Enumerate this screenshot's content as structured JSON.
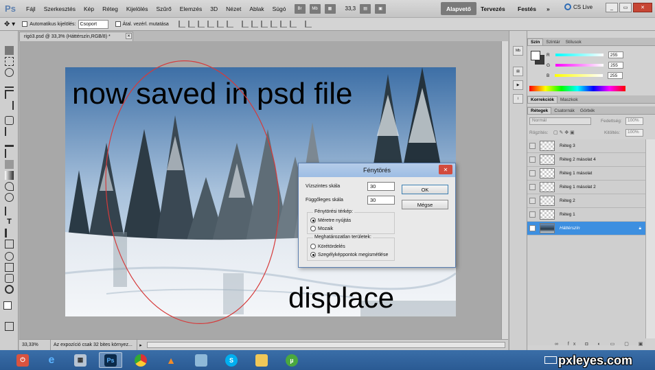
{
  "app": {
    "logo": "Ps",
    "menu": [
      "Fájl",
      "Szerkesztés",
      "Kép",
      "Réteg",
      "Kijelölés",
      "Szűrő",
      "Elemzés",
      "3D",
      "Nézet",
      "Ablak",
      "Súgó"
    ],
    "zoom": "33,3",
    "workspaces": [
      "Alapvető",
      "Tervezés",
      "Festés"
    ],
    "more": "»",
    "cs_live": "CS Live"
  },
  "options": {
    "auto_select_label": "Automatikus kijelölés:",
    "auto_select_value": "Csoport",
    "transform_label": "Átal. vezérl. mutatása"
  },
  "document": {
    "tab_title": "rigó3.psd @ 33,3% (Háttérszín,RGB/8) *",
    "overlay_text_1": "now saved in psd file",
    "overlay_text_2": "displace",
    "status_zoom": "33,33%",
    "status_info": "Az expozíció csak 32 bites környez..."
  },
  "dialog": {
    "title": "Fénytörés",
    "horizontal_label": "Vízszintes skála",
    "horizontal_value": "30",
    "vertical_label": "Függőleges skála",
    "vertical_value": "30",
    "ok_label": "OK",
    "cancel_label": "Mégse",
    "map_group": "Fénytörési térkép:",
    "map_options": [
      "Méretre nyújtás",
      "Mozaik"
    ],
    "undefined_group": "Meghatározatlan területek:",
    "undefined_options": [
      "Körétördelés",
      "Szegélyképpontok megismétlése"
    ]
  },
  "color_panel": {
    "tabs": [
      "Szín",
      "Szintár",
      "Stílusok"
    ],
    "r_label": "R",
    "r_value": "255",
    "g_label": "G",
    "g_value": "255",
    "b_label": "B",
    "b_value": "255"
  },
  "adjust_tabs": [
    "Korrekciók",
    "Maszkok"
  ],
  "layers_panel": {
    "tabs": [
      "Rétegek",
      "Csatornák",
      "Görbék"
    ],
    "blend_mode": "Normál",
    "opacity_label": "Fedettség:",
    "opacity_value": "100%",
    "lock_label": "Rögzítés:",
    "fill_label": "Kitöltés:",
    "fill_value": "100%",
    "layers": [
      "Réteg 3",
      "Réteg 2 másolat 4",
      "Réteg 1 másolat",
      "Réteg 1 másolat 2",
      "Réteg 2",
      "Réteg 1",
      "Háttérszín"
    ]
  },
  "taskbar": {
    "watermark": "pxleyes.com"
  },
  "colors": {
    "accent": "#3d8fe0",
    "taskbar": "#2a5a93",
    "close": "#d24b3e"
  }
}
